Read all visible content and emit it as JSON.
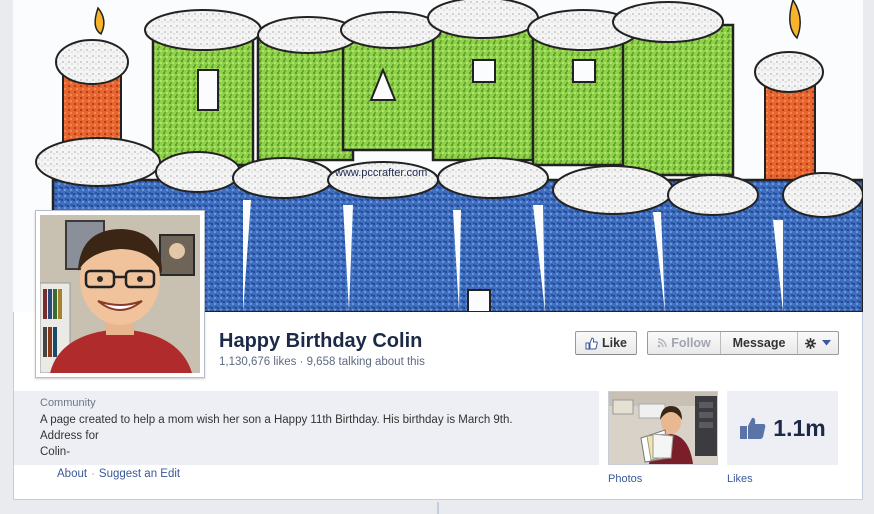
{
  "page": {
    "name": "Happy Birthday Colin",
    "stats": "1,130,676 likes · 9,658 talking about this",
    "cover_watermark": "www.pccrafter.com"
  },
  "buttons": {
    "like": "Like",
    "follow": "Follow",
    "message": "Message"
  },
  "about": {
    "category": "Community",
    "description_lines": [
      "A page created to help a mom wish her son a Happy 11th Birthday. His birthday is March 9th.",
      "Address for",
      "Colin-"
    ],
    "link_about": "About",
    "link_separator": "·",
    "link_suggest": "Suggest an Edit"
  },
  "apps": {
    "photos_label": "Photos",
    "likes_label": "Likes",
    "likes_count": "1.1m"
  },
  "colors": {
    "brand": "#3b5998",
    "title": "#1c2a47"
  }
}
